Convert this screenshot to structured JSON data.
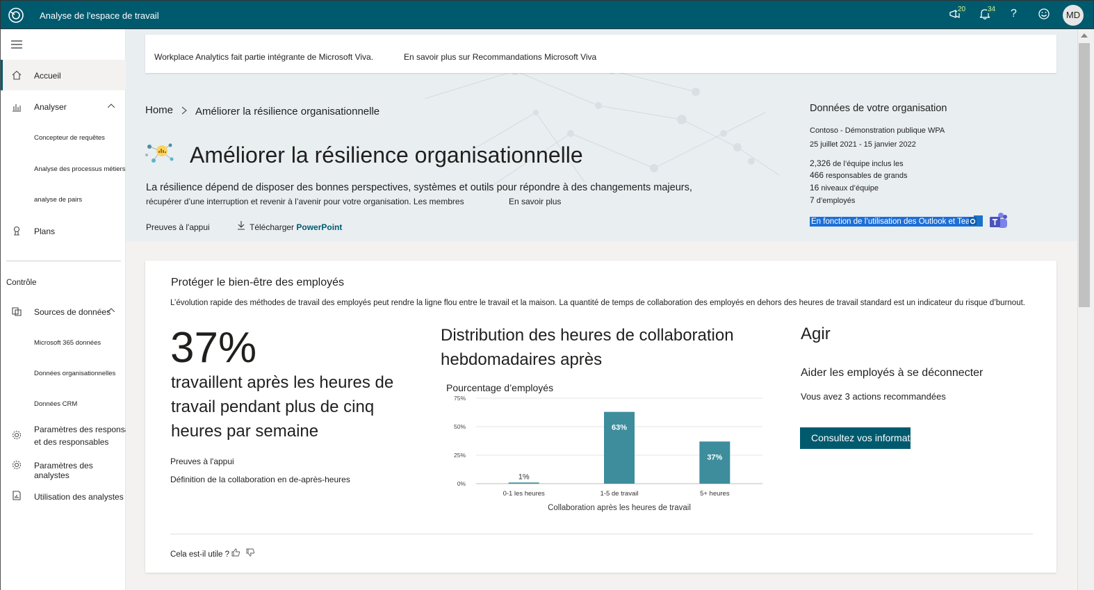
{
  "topbar": {
    "app_title": "Analyse de l'espace de travail",
    "icons": [
      "megaphone-icon",
      "bell-icon",
      "help-icon",
      "feedback-smiley-icon"
    ],
    "megaphone_badge": "20",
    "bell_badge": "34",
    "help_label": "?",
    "avatar_initials": "MD"
  },
  "sidebar": {
    "items": [
      {
        "label": "Accueil",
        "icon": "home-icon",
        "active": true
      },
      {
        "label": "Analyser",
        "icon": "chart-icon"
      },
      {
        "label": "Concepteur de requêtes"
      },
      {
        "label": "Analyse des processus métiers"
      },
      {
        "label": "analyse de pairs"
      },
      {
        "label": "Plans",
        "icon": "plans-icon"
      }
    ],
    "section_label": "Contrôle",
    "control_items": [
      {
        "label": "Sources de données",
        "icon": "data-sources-icon"
      },
      {
        "label": "Microsoft 365 données"
      },
      {
        "label": "Données organisationnelles"
      },
      {
        "label": "Données CRM"
      },
      {
        "label": "Paramètres des responsables et des responsables",
        "icon": "gear-icon"
      },
      {
        "label": "Paramètres des analystes",
        "icon": "gear-icon"
      },
      {
        "label": "Utilisation des analystes",
        "icon": "report-icon"
      }
    ]
  },
  "banner": {
    "text": "Workplace Analytics fait partie intégrante de Microsoft Viva.",
    "link": "En savoir plus sur Recommandations Microsoft Viva"
  },
  "breadcrumb": {
    "home": "Home",
    "current": "Améliorer la résilience organisationnelle"
  },
  "hero": {
    "title": "Améliorer la résilience organisationnelle",
    "desc_line1": "La résilience dépend de disposer des bonnes perspectives, systèmes et outils pour répondre à des changements majeurs,",
    "desc_line2": "récupérer d’une interruption et revenir à l’avenir pour votre organisation. Les membres",
    "learn_more": "En savoir plus",
    "evidence": "Preuves à l'appui",
    "download": "Télécharger",
    "powerpoint": "PowerPoint"
  },
  "org": {
    "title": "Données de votre organisation",
    "company": "Contoso - Démonstration publique WPA",
    "date_range": "25 juillet 2021 - 15 janvier 2022",
    "stats": [
      {
        "num": "2,326",
        "label": "de l’équipe inclus les"
      },
      {
        "num": "466",
        "label": "responsables de grands"
      },
      {
        "num": "16",
        "label": "niveaux d’équipe"
      },
      {
        "num": "7",
        "label": "d’employés"
      }
    ],
    "source_note": "En fonction de l’utilisation des Outlook et Teams"
  },
  "card": {
    "title": "Protéger le bien-être des employés",
    "desc": "L’évolution rapide des méthodes de travail des employés peut rendre la ligne flou entre le travail et la maison. La quantité de temps de collaboration des employés en dehors des heures de travail standard est un indicateur du risque d’burnout.",
    "big_pct": "37%",
    "stat_text": "travaillent après les heures de travail pendant plus de cinq heures par semaine",
    "evidence": "Preuves à l'appui",
    "definition": "Définition de la collaboration en de-après-heures",
    "chart_title": "Distribution des heures de collaboration hebdomadaires après",
    "action_title": "Agir",
    "action_sub": "Aider les employés à se déconnecter",
    "action_count": "Vous avez 3 actions recommandées",
    "action_button": "Consultez vos informations",
    "useful": "Cela est-il utile ?"
  },
  "chart_data": {
    "type": "bar",
    "ylabel": "Pourcentage d’employés",
    "xlabel": "Collaboration après les heures de travail",
    "categories": [
      "0-1 les heures",
      "1-5 de travail",
      "5+ heures"
    ],
    "values": [
      1,
      63,
      37
    ],
    "data_labels": [
      "1%",
      "63%",
      "37%"
    ],
    "yticks": [
      "0%",
      "25%",
      "50%",
      "75%"
    ],
    "ylim": [
      0,
      75
    ],
    "grid": true,
    "bar_color": "#3d8d9d"
  }
}
